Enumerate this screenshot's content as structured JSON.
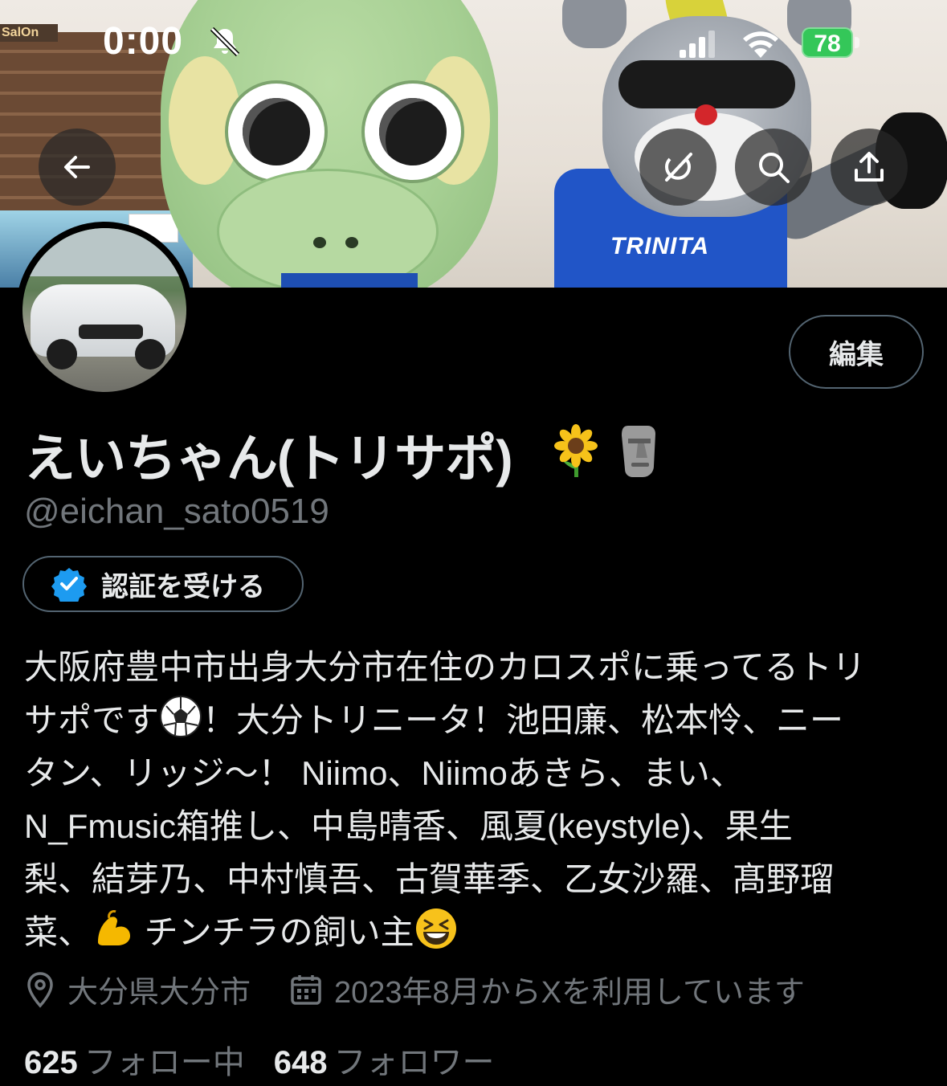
{
  "status_bar": {
    "time": "0:00",
    "battery_level": "78",
    "icons": [
      "mute-icon",
      "cellular-signal-icon",
      "wifi-icon",
      "battery-charging-icon"
    ]
  },
  "banner": {
    "sign_text": "SalOn",
    "shirt_logo": "TRINITA",
    "buttons": [
      "back-arrow-icon",
      "grok-icon",
      "search-icon",
      "share-icon"
    ]
  },
  "profile": {
    "display_name": "えいちゃん(トリサポ)",
    "name_emojis": [
      "sunflower-icon",
      "moai-icon"
    ],
    "handle": "@eichan_sato0519",
    "edit_label": "編集",
    "verify_label": "認証を受ける",
    "bio_lines": [
      "大阪府豊中市出身大分市在住のカロスポに乗ってるトリ",
      [
        "サポです",
        "soccer-ball-emoji",
        "！大分トリニータ！池田廉、松本怜、ニー"
      ],
      "タン、リッジ〜！ Niimo、Niimoあきら、まい、",
      "N_Fmusic箱推し、中島晴香、風夏(keystyle)、果生",
      "梨、結芽乃、中村慎吾、古賀華季、乙女沙羅、髙野瑠",
      [
        "菜、",
        "flexed-biceps-emoji",
        " チンチラの飼い主",
        "grinning-squinting-face-emoji"
      ]
    ],
    "location": "大分県大分市",
    "joined": "2023年8月からXを利用しています",
    "following_count": "625",
    "following_label": "フォロー中",
    "followers_count": "648",
    "followers_label": "フォロワー"
  },
  "colors": {
    "background": "#000000",
    "text_primary": "#e7e9ea",
    "text_secondary": "#71767b",
    "border": "#536471",
    "verified_blue": "#1d9bf0",
    "battery_green": "#34c759"
  }
}
